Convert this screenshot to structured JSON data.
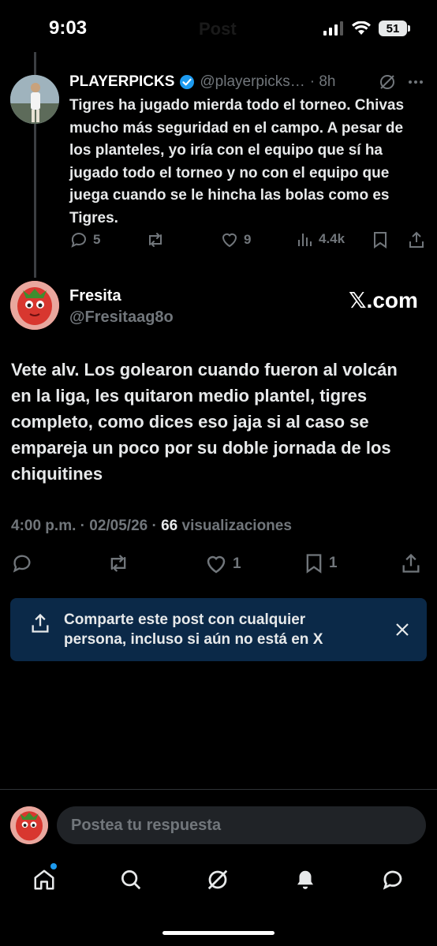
{
  "status_bar": {
    "time": "9:03",
    "battery": "51",
    "ghost_title": "Post"
  },
  "parent_post": {
    "display_name": "PLAYERPICKS",
    "handle": "@playerpicks…",
    "time": "· 8h",
    "text": "Tigres ha jugado mierda todo el torneo. Chivas mucho más seguridad en el campo. A pesar de los planteles, yo iría con el equipo que sí ha jugado todo el torneo y no con el equipo que juega cuando se le hincha las bolas como es Tigres.",
    "replies": "5",
    "reposts": "",
    "likes": "9",
    "views": "4.4k"
  },
  "main_post": {
    "display_name": "Fresita",
    "handle": "@Fresitaag8o",
    "brand": "𝕏.com",
    "text": "Vete alv. Los golearon cuando fueron al volcán en la liga, les quitaron medio plantel, tigres completo, como dices eso jaja si al caso se empareja un poco por su doble jornada de los chiquitines",
    "timestamp": "4:00 p.m. · 02/05/26 · ",
    "views_count": "66",
    "views_label": " visualizaciones",
    "likes": "1",
    "bookmarks": "1"
  },
  "share_banner": {
    "text": "Comparte este post con cualquier persona, incluso si aún no está en X"
  },
  "reply": {
    "placeholder": "Postea tu respuesta"
  },
  "colors": {
    "accent": "#1d9bf0",
    "banner": "#0b2948",
    "muted": "#71767b"
  }
}
